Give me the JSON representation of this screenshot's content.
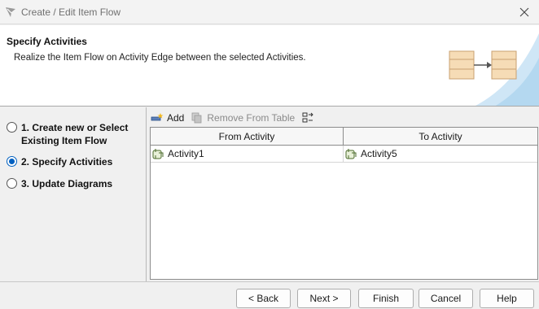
{
  "window": {
    "title": "Create / Edit Item Flow"
  },
  "header": {
    "title": "Specify Activities",
    "description": "Realize the Item Flow on Activity Edge between the selected Activities."
  },
  "steps": [
    {
      "label": "1. Create new or Select Existing Item Flow",
      "selected": false
    },
    {
      "label": "2. Specify Activities",
      "selected": true
    },
    {
      "label": "3. Update Diagrams",
      "selected": false
    }
  ],
  "toolbar": {
    "add_label": "Add",
    "remove_label": "Remove From Table"
  },
  "table": {
    "columns": [
      "From Activity",
      "To Activity"
    ],
    "rows": [
      [
        "Activity1",
        "Activity5"
      ]
    ]
  },
  "buttons": {
    "back": "< Back",
    "next": "Next >",
    "finish": "Finish",
    "cancel": "Cancel",
    "help": "Help"
  }
}
